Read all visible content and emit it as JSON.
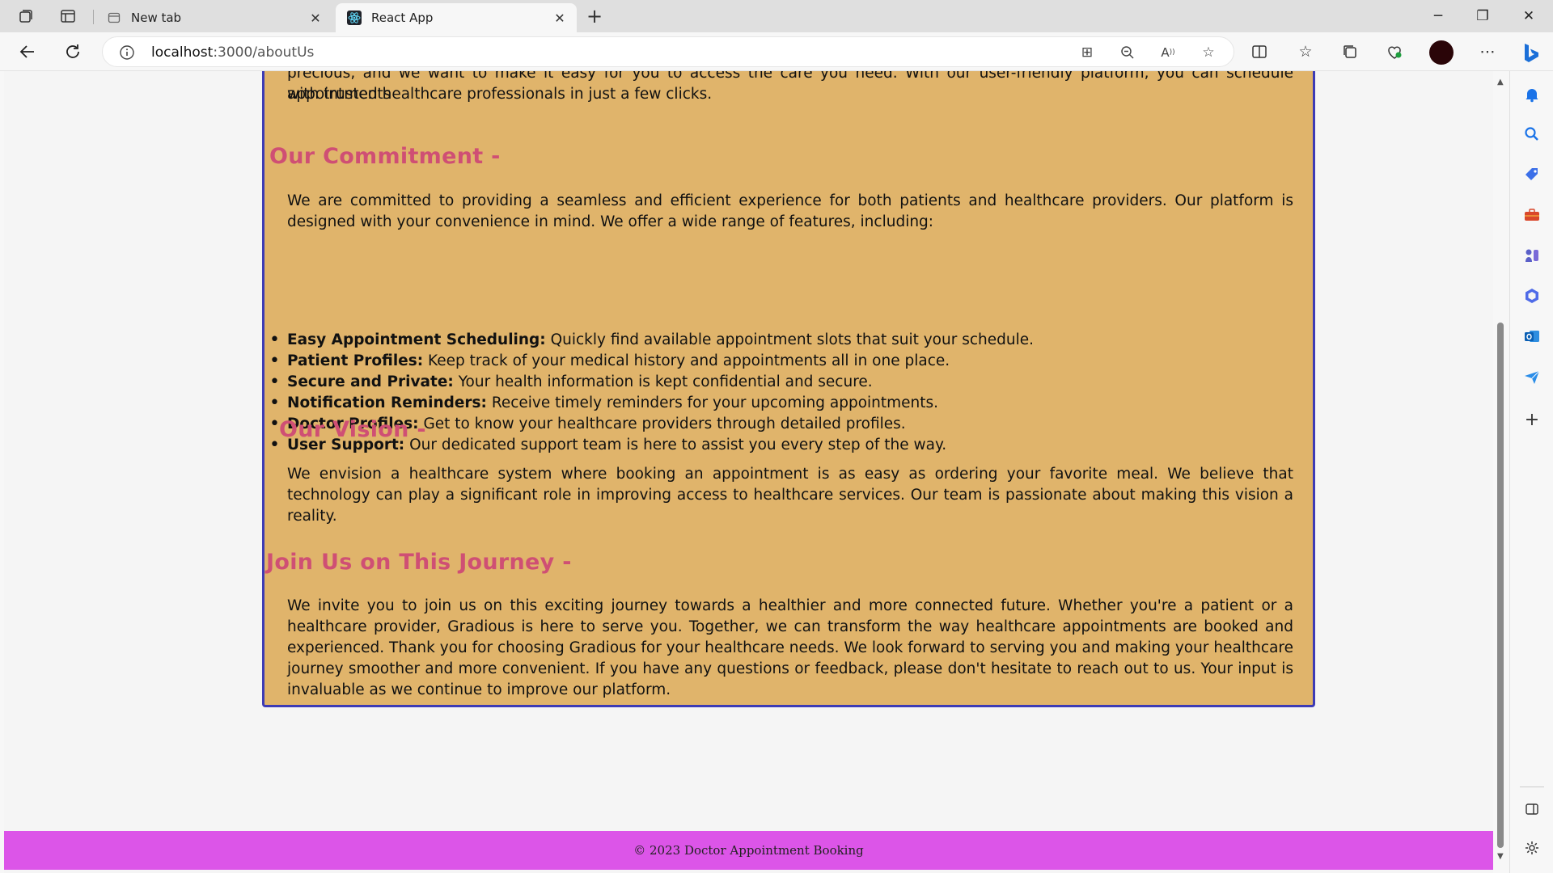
{
  "browser": {
    "tabs": [
      {
        "title": "New tab",
        "active": false
      },
      {
        "title": "React App",
        "active": true
      }
    ],
    "url_host": "localhost",
    "url_path": ":3000/aboutUs"
  },
  "page": {
    "intro_partial_line1": "precious, and we want to make it easy for you to access the care you need. With our user-friendly platform, you can schedule appointments",
    "intro_partial_line2": "with trusted healthcare professionals in just a few clicks.",
    "commitment": {
      "heading": "Our Commitment -",
      "text": "We are committed to providing a seamless and efficient experience for both patients and healthcare providers. Our platform is designed with your convenience in mind. We offer a wide range of features, including:",
      "features": [
        {
          "title": "Easy Appointment Scheduling:",
          "text": " Quickly find available appointment slots that suit your schedule."
        },
        {
          "title": "Patient Profiles:",
          "text": " Keep track of your medical history and appointments all in one place."
        },
        {
          "title": "Secure and Private:",
          "text": " Your health information is kept confidential and secure."
        },
        {
          "title": "Notification Reminders:",
          "text": " Receive timely reminders for your upcoming appointments."
        },
        {
          "title": "Doctor Profiles:",
          "text": " Get to know your healthcare providers through detailed profiles."
        },
        {
          "title": "User Support:",
          "text": " Our dedicated support team is here to assist you every step of the way."
        }
      ]
    },
    "vision": {
      "heading": "Our Vision -",
      "text": "We envision a healthcare system where booking an appointment is as easy as ordering your favorite meal. We believe that technology can play a significant role in improving access to healthcare services. Our team is passionate about making this vision a reality."
    },
    "journey": {
      "heading": "Join Us on This Journey -",
      "text": "We invite you to join us on this exciting journey towards a healthier and more connected future. Whether you're a patient or a healthcare provider, Gradious is here to serve you. Together, we can transform the way healthcare appointments are booked and experienced. Thank you for choosing Gradious for your healthcare needs. We look forward to serving you and making your healthcare journey smoother and more convenient. If you have any questions or feedback, please don't hesitate to reach out to us. Your input is invaluable as we continue to improve our platform."
    },
    "footer": "© 2023 Doctor Appointment Booking"
  },
  "colors": {
    "card_bg": "#e0b46b",
    "card_border": "#3d3bb5",
    "heading": "#cf4f74",
    "footer_bg": "#dc55e8"
  }
}
